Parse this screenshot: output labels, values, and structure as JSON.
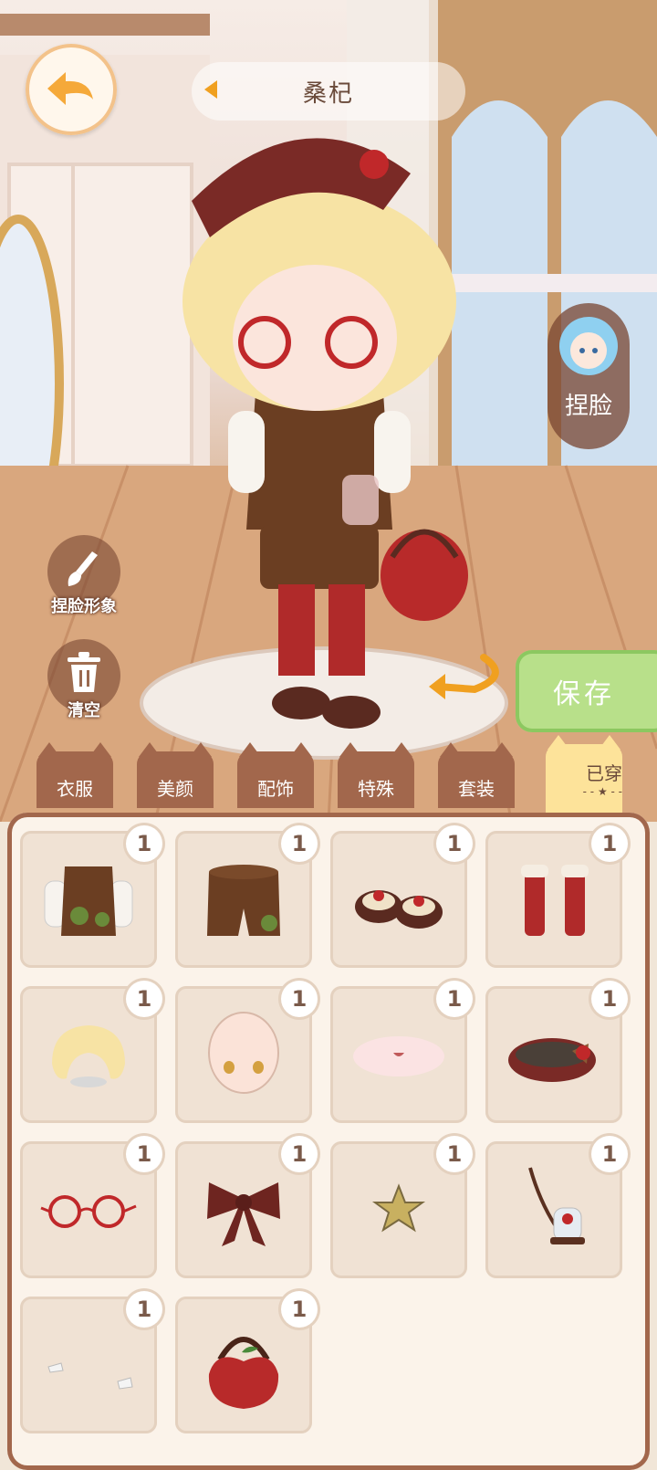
{
  "header": {
    "character_name": "桑杞"
  },
  "side_buttons": {
    "face_edit_label": "捏脸"
  },
  "tools": {
    "face_image_label": "捏脸形象",
    "clear_label": "清空"
  },
  "actions": {
    "save_label": "保存"
  },
  "tabs": [
    {
      "label": "衣服",
      "active": false
    },
    {
      "label": "美颜",
      "active": false
    },
    {
      "label": "配饰",
      "active": false
    },
    {
      "label": "特殊",
      "active": false
    },
    {
      "label": "套装",
      "active": false
    },
    {
      "label": "已穿",
      "active": true
    }
  ],
  "worn_items": [
    {
      "icon": "vest-top-icon",
      "count": "1"
    },
    {
      "icon": "shorts-icon",
      "count": "1"
    },
    {
      "icon": "shoes-icon",
      "count": "1"
    },
    {
      "icon": "socks-icon",
      "count": "1"
    },
    {
      "icon": "blonde-hair-icon",
      "count": "1"
    },
    {
      "icon": "face-base-icon",
      "count": "1"
    },
    {
      "icon": "mouth-icon",
      "count": "1"
    },
    {
      "icon": "beret-hat-icon",
      "count": "1"
    },
    {
      "icon": "round-glasses-icon",
      "count": "1"
    },
    {
      "icon": "bow-icon",
      "count": "1"
    },
    {
      "icon": "star-badge-icon",
      "count": "1"
    },
    {
      "icon": "rose-jar-bag-icon",
      "count": "1"
    },
    {
      "icon": "gloves-icon",
      "count": "1"
    },
    {
      "icon": "apple-bag-icon",
      "count": "1"
    }
  ]
}
